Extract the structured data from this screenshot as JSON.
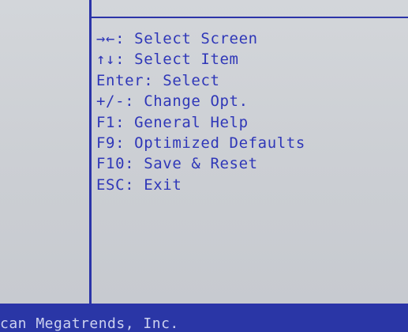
{
  "help": {
    "lines": [
      {
        "key": "→←",
        "sep": ":",
        "action": " Select Screen"
      },
      {
        "key": "↑↓",
        "sep": ":",
        "action": " Select Item"
      },
      {
        "key": "Enter",
        "sep": ":",
        "action": " Select"
      },
      {
        "key": "+/-",
        "sep": ":",
        "action": " Change Opt."
      },
      {
        "key": "F1",
        "sep": ":",
        "action": " General Help"
      },
      {
        "key": "F9",
        "sep": ":",
        "action": " Optimized Defaults"
      },
      {
        "key": "F10",
        "sep": ":",
        "action": " Save & Reset"
      },
      {
        "key": "ESC",
        "sep": ":",
        "action": " Exit"
      }
    ]
  },
  "footer": {
    "copyright": "can Megatrends, Inc."
  },
  "colors": {
    "text_blue": "#2f37b8",
    "line_blue": "#2b34a8",
    "screen_bg": "#cfd2d6"
  }
}
